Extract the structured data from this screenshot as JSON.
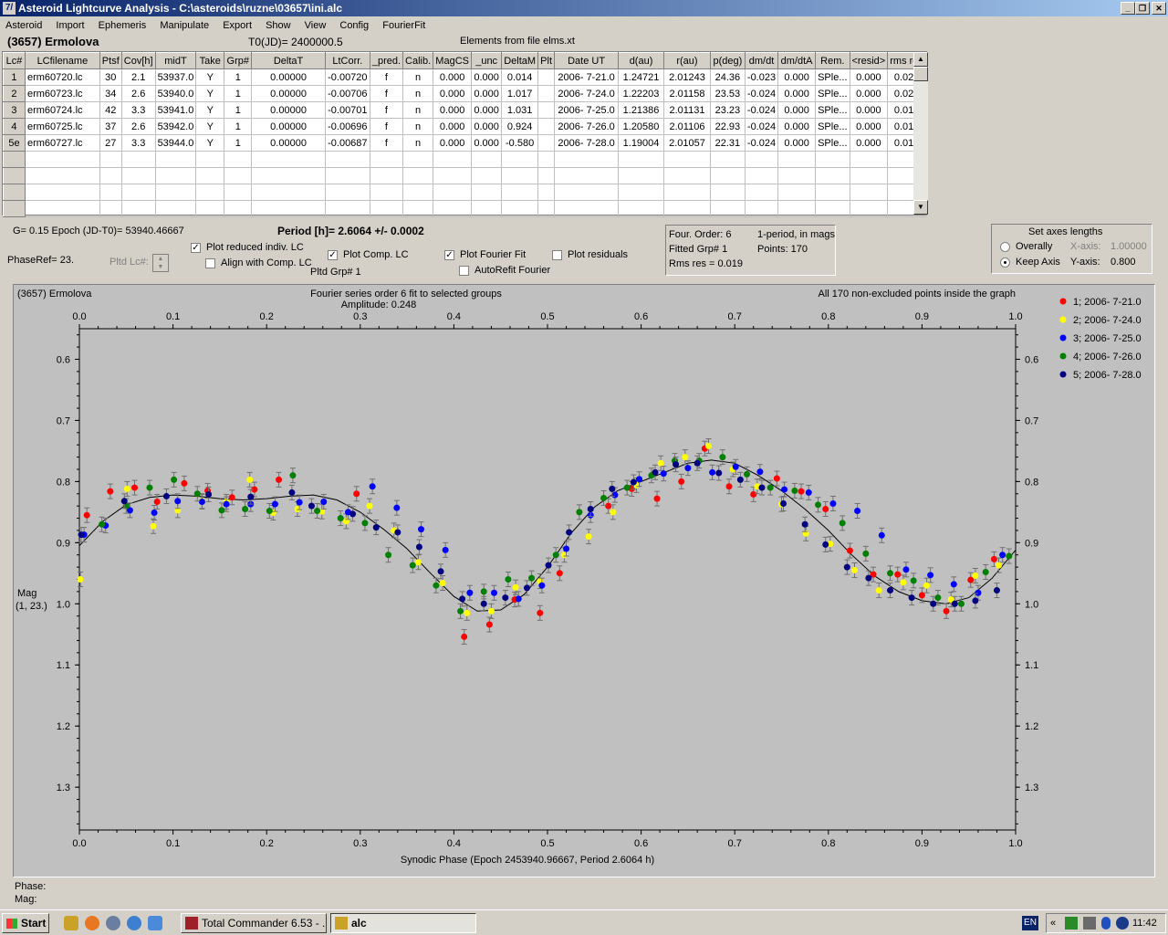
{
  "window": {
    "title": "Asteroid Lightcurve Analysis - C:\\asteroids\\ruzne\\03657\\ini.alc",
    "app_icon": "7/",
    "min": "_",
    "max": "❐",
    "close": "✕"
  },
  "menu": [
    "Asteroid",
    "Import",
    "Ephemeris",
    "Manipulate",
    "Export",
    "Show",
    "View",
    "Config",
    "FourierFit"
  ],
  "header": {
    "asteroid": "(3657) Ermolova",
    "t0": "T0(JD)= 2400000.5",
    "elements": "Elements from file elms.xt"
  },
  "grid": {
    "columns": [
      "Lc#",
      "LCfilename",
      "Ptsf",
      "Cov[h]",
      "midT",
      "Take",
      "Grp#",
      "DeltaT",
      "LtCorr.",
      "_pred.",
      "Calib.",
      "MagCS",
      "_unc",
      "DeltaM",
      "Plt",
      "Date UT",
      "d(au)",
      "r(au)",
      "p(deg)",
      "dm/dt",
      "dm/dtA",
      "Rem.",
      "<resid>",
      "rms res"
    ],
    "rows": [
      [
        "1",
        "erm60720.lc",
        "30",
        "2.1",
        "53937.0",
        "Y",
        "1",
        "0.00000",
        "-0.00720",
        "f",
        "n",
        "0.000",
        "0.000",
        "0.014",
        "",
        "2006- 7-21.0",
        "1.24721",
        "2.01243",
        "24.36",
        "-0.023",
        "0.000",
        "SPle...",
        "0.000",
        "0.026"
      ],
      [
        "2",
        "erm60723.lc",
        "34",
        "2.6",
        "53940.0",
        "Y",
        "1",
        "0.00000",
        "-0.00706",
        "f",
        "n",
        "0.000",
        "0.000",
        "1.017",
        "",
        "2006- 7-24.0",
        "1.22203",
        "2.01158",
        "23.53",
        "-0.024",
        "0.000",
        "SPle...",
        "0.000",
        "0.021"
      ],
      [
        "3",
        "erm60724.lc",
        "42",
        "3.3",
        "53941.0",
        "Y",
        "1",
        "0.00000",
        "-0.00701",
        "f",
        "n",
        "0.000",
        "0.000",
        "1.031",
        "",
        "2006- 7-25.0",
        "1.21386",
        "2.01131",
        "23.23",
        "-0.024",
        "0.000",
        "SPle...",
        "0.000",
        "0.015"
      ],
      [
        "4",
        "erm60725.lc",
        "37",
        "2.6",
        "53942.0",
        "Y",
        "1",
        "0.00000",
        "-0.00696",
        "f",
        "n",
        "0.000",
        "0.000",
        "0.924",
        "",
        "2006- 7-26.0",
        "1.20580",
        "2.01106",
        "22.93",
        "-0.024",
        "0.000",
        "SPle...",
        "0.000",
        "0.016"
      ],
      [
        "5e",
        "erm60727.lc",
        "27",
        "3.3",
        "53944.0",
        "Y",
        "1",
        "0.00000",
        "-0.00687",
        "f",
        "n",
        "0.000",
        "0.000",
        "-0.580",
        "",
        "2006- 7-28.0",
        "1.19004",
        "2.01057",
        "22.31",
        "-0.024",
        "0.000",
        "SPle...",
        "0.000",
        "0.013"
      ]
    ]
  },
  "controls": {
    "g_epoch": "G= 0.15    Epoch (JD-T0)= 53940.46667",
    "period": "Period [h]= 2.6064 +/- 0.0002",
    "phaseref": "PhaseRef= 23.",
    "pltd_lc": "Pltd Lc#:",
    "plot_reduced": "Plot reduced indiv. LC",
    "align_comp": "Align with Comp. LC",
    "plot_comp": "Plot Comp. LC",
    "pltd_grp": "Pltd Grp#  1",
    "plot_fourier": "Plot Fourier Fit",
    "autorefit": "AutoRefit Fourier",
    "plot_residuals": "Plot residuals"
  },
  "fourier_panel": {
    "order": "Four. Order:  6",
    "fitted": "Fitted Grp# 1",
    "rms": "Rms res      = 0.019",
    "mode": "1-period, in mags",
    "points": "Points: 170"
  },
  "axes_panel": {
    "title": "Set axes lengths",
    "overally": "Overally",
    "keep": "Keep Axis",
    "xaxis_label": "X-axis:",
    "xaxis_val": "1.00000",
    "yaxis_label": "Y-axis:",
    "yaxis_val": "0.800"
  },
  "chart_data": {
    "type": "scatter",
    "title": "Fourier series order 6 fit to selected groups",
    "subtitle": "Amplitude: 0.248",
    "object": "(3657) Ermolova",
    "note": "All 170 non-excluded points inside the graph",
    "xlabel": "Synodic Phase (Epoch 2453940.96667, Period 2.6064 h)",
    "ylabel": "Mag\n(1, 23.)",
    "xlim": [
      0.0,
      1.0
    ],
    "ylim": [
      0.55,
      1.37
    ],
    "y_inverted": true,
    "xticks": [
      "0.0",
      "0.1",
      "0.2",
      "0.3",
      "0.4",
      "0.5",
      "0.6",
      "0.7",
      "0.8",
      "0.9",
      "1.0"
    ],
    "yticks": [
      "0.6",
      "0.7",
      "0.8",
      "0.9",
      "1.0",
      "1.1",
      "1.2",
      "1.3"
    ],
    "legend_position": "right",
    "fit_curve": {
      "phase": [
        0,
        0.025,
        0.05,
        0.075,
        0.1,
        0.125,
        0.15,
        0.175,
        0.2,
        0.225,
        0.25,
        0.275,
        0.3,
        0.325,
        0.35,
        0.375,
        0.4,
        0.425,
        0.45,
        0.475,
        0.5,
        0.525,
        0.55,
        0.575,
        0.6,
        0.625,
        0.65,
        0.675,
        0.7,
        0.725,
        0.75,
        0.775,
        0.8,
        0.825,
        0.85,
        0.875,
        0.9,
        0.925,
        0.95,
        0.975,
        1.0
      ],
      "mag": [
        0.905,
        0.865,
        0.838,
        0.826,
        0.822,
        0.824,
        0.828,
        0.83,
        0.828,
        0.824,
        0.822,
        0.83,
        0.85,
        0.878,
        0.91,
        0.95,
        0.988,
        1.012,
        1.01,
        0.985,
        0.94,
        0.885,
        0.842,
        0.815,
        0.8,
        0.785,
        0.77,
        0.765,
        0.77,
        0.79,
        0.815,
        0.845,
        0.88,
        0.92,
        0.955,
        0.98,
        0.995,
        1.0,
        0.99,
        0.958,
        0.912
      ]
    },
    "series": [
      {
        "name": "1; 2006- 7-21.0",
        "color": "#ff0000",
        "x": [
          0.008,
          0.033,
          0.059,
          0.083,
          0.112,
          0.137,
          0.163,
          0.187,
          0.213,
          0.296,
          0.411,
          0.438,
          0.465,
          0.492,
          0.513,
          0.565,
          0.59,
          0.617,
          0.643,
          0.668,
          0.694,
          0.72,
          0.745,
          0.771,
          0.797,
          0.823,
          0.848,
          0.874,
          0.9,
          0.926,
          0.952,
          0.977
        ],
        "y": [
          0.855,
          0.816,
          0.81,
          0.833,
          0.803,
          0.815,
          0.826,
          0.813,
          0.797,
          0.82,
          1.054,
          1.034,
          0.993,
          1.015,
          0.95,
          0.84,
          0.812,
          0.828,
          0.8,
          0.746,
          0.808,
          0.821,
          0.795,
          0.816,
          0.845,
          0.913,
          0.952,
          0.952,
          0.986,
          1.012,
          0.961,
          0.927
        ]
      },
      {
        "name": "2; 2006- 7-24.0",
        "color": "#ffff00",
        "x": [
          0.001,
          0.051,
          0.079,
          0.105,
          0.131,
          0.157,
          0.182,
          0.207,
          0.233,
          0.259,
          0.285,
          0.31,
          0.336,
          0.362,
          0.388,
          0.414,
          0.44,
          0.466,
          0.492,
          0.518,
          0.544,
          0.57,
          0.595,
          0.621,
          0.647,
          0.672,
          0.698,
          0.724,
          0.75,
          0.776,
          0.802,
          0.828,
          0.854,
          0.88,
          0.905,
          0.931,
          0.957,
          0.982
        ],
        "y": [
          0.96,
          0.812,
          0.873,
          0.847,
          0.832,
          0.833,
          0.797,
          0.851,
          0.845,
          0.849,
          0.865,
          0.84,
          0.88,
          0.932,
          0.966,
          1.015,
          1.012,
          0.973,
          0.963,
          0.92,
          0.89,
          0.85,
          0.806,
          0.77,
          0.76,
          0.742,
          0.78,
          0.808,
          0.837,
          0.885,
          0.902,
          0.945,
          0.978,
          0.965,
          0.97,
          0.993,
          0.954,
          0.937
        ]
      },
      {
        "name": "3; 2006- 7-25.0",
        "color": "#0000ff",
        "x": [
          0.005,
          0.028,
          0.054,
          0.08,
          0.105,
          0.131,
          0.157,
          0.183,
          0.209,
          0.235,
          0.261,
          0.287,
          0.313,
          0.339,
          0.365,
          0.391,
          0.417,
          0.443,
          0.469,
          0.494,
          0.52,
          0.546,
          0.572,
          0.598,
          0.624,
          0.65,
          0.676,
          0.701,
          0.727,
          0.753,
          0.779,
          0.805,
          0.831,
          0.857,
          0.883,
          0.909,
          0.934,
          0.96,
          0.986
        ],
        "y": [
          0.887,
          0.872,
          0.847,
          0.851,
          0.832,
          0.833,
          0.837,
          0.837,
          0.837,
          0.834,
          0.833,
          0.85,
          0.808,
          0.843,
          0.878,
          0.912,
          0.982,
          0.982,
          0.992,
          0.97,
          0.91,
          0.855,
          0.822,
          0.796,
          0.787,
          0.778,
          0.785,
          0.776,
          0.784,
          0.813,
          0.818,
          0.836,
          0.848,
          0.888,
          0.944,
          0.953,
          0.968,
          0.982,
          0.92
        ]
      },
      {
        "name": "4; 2006- 7-26.0",
        "color": "#008000",
        "x": [
          0.024,
          0.05,
          0.075,
          0.101,
          0.126,
          0.152,
          0.177,
          0.203,
          0.228,
          0.254,
          0.279,
          0.305,
          0.33,
          0.356,
          0.381,
          0.407,
          0.432,
          0.458,
          0.483,
          0.509,
          0.534,
          0.56,
          0.585,
          0.611,
          0.636,
          0.662,
          0.687,
          0.713,
          0.738,
          0.764,
          0.789,
          0.815,
          0.84,
          0.866,
          0.891,
          0.917,
          0.942,
          0.968,
          0.993
        ],
        "y": [
          0.87,
          0.84,
          0.81,
          0.797,
          0.82,
          0.847,
          0.845,
          0.848,
          0.79,
          0.848,
          0.86,
          0.868,
          0.92,
          0.937,
          0.97,
          1.012,
          0.98,
          0.96,
          0.958,
          0.92,
          0.85,
          0.827,
          0.81,
          0.79,
          0.766,
          0.766,
          0.76,
          0.788,
          0.81,
          0.815,
          0.838,
          0.868,
          0.918,
          0.95,
          0.962,
          0.99,
          1.0,
          0.948,
          0.922
        ]
      },
      {
        "name": "5; 2006- 7-28.0",
        "color": "#000080",
        "x": [
          0.002,
          0.048,
          0.093,
          0.138,
          0.183,
          0.227,
          0.248,
          0.292,
          0.317,
          0.34,
          0.363,
          0.386,
          0.409,
          0.432,
          0.455,
          0.478,
          0.501,
          0.523,
          0.546,
          0.569,
          0.592,
          0.615,
          0.637,
          0.66,
          0.683,
          0.706,
          0.729,
          0.752,
          0.775,
          0.797,
          0.82,
          0.843,
          0.866,
          0.889,
          0.912,
          0.935,
          0.957,
          0.98
        ],
        "y": [
          0.887,
          0.832,
          0.824,
          0.821,
          0.825,
          0.818,
          0.84,
          0.853,
          0.875,
          0.883,
          0.907,
          0.947,
          0.992,
          1.0,
          0.99,
          0.974,
          0.937,
          0.883,
          0.845,
          0.812,
          0.801,
          0.785,
          0.772,
          0.77,
          0.786,
          0.797,
          0.81,
          0.836,
          0.87,
          0.903,
          0.94,
          0.958,
          0.978,
          0.99,
          1.0,
          1.0,
          0.995,
          0.978
        ]
      }
    ]
  },
  "status": {
    "phase": "Phase:",
    "mag": "Mag:"
  },
  "taskbar": {
    "start": "Start",
    "tasks": [
      "Total Commander 6.53 - ...",
      "alc"
    ],
    "lang": "EN",
    "clock": "11:42"
  }
}
